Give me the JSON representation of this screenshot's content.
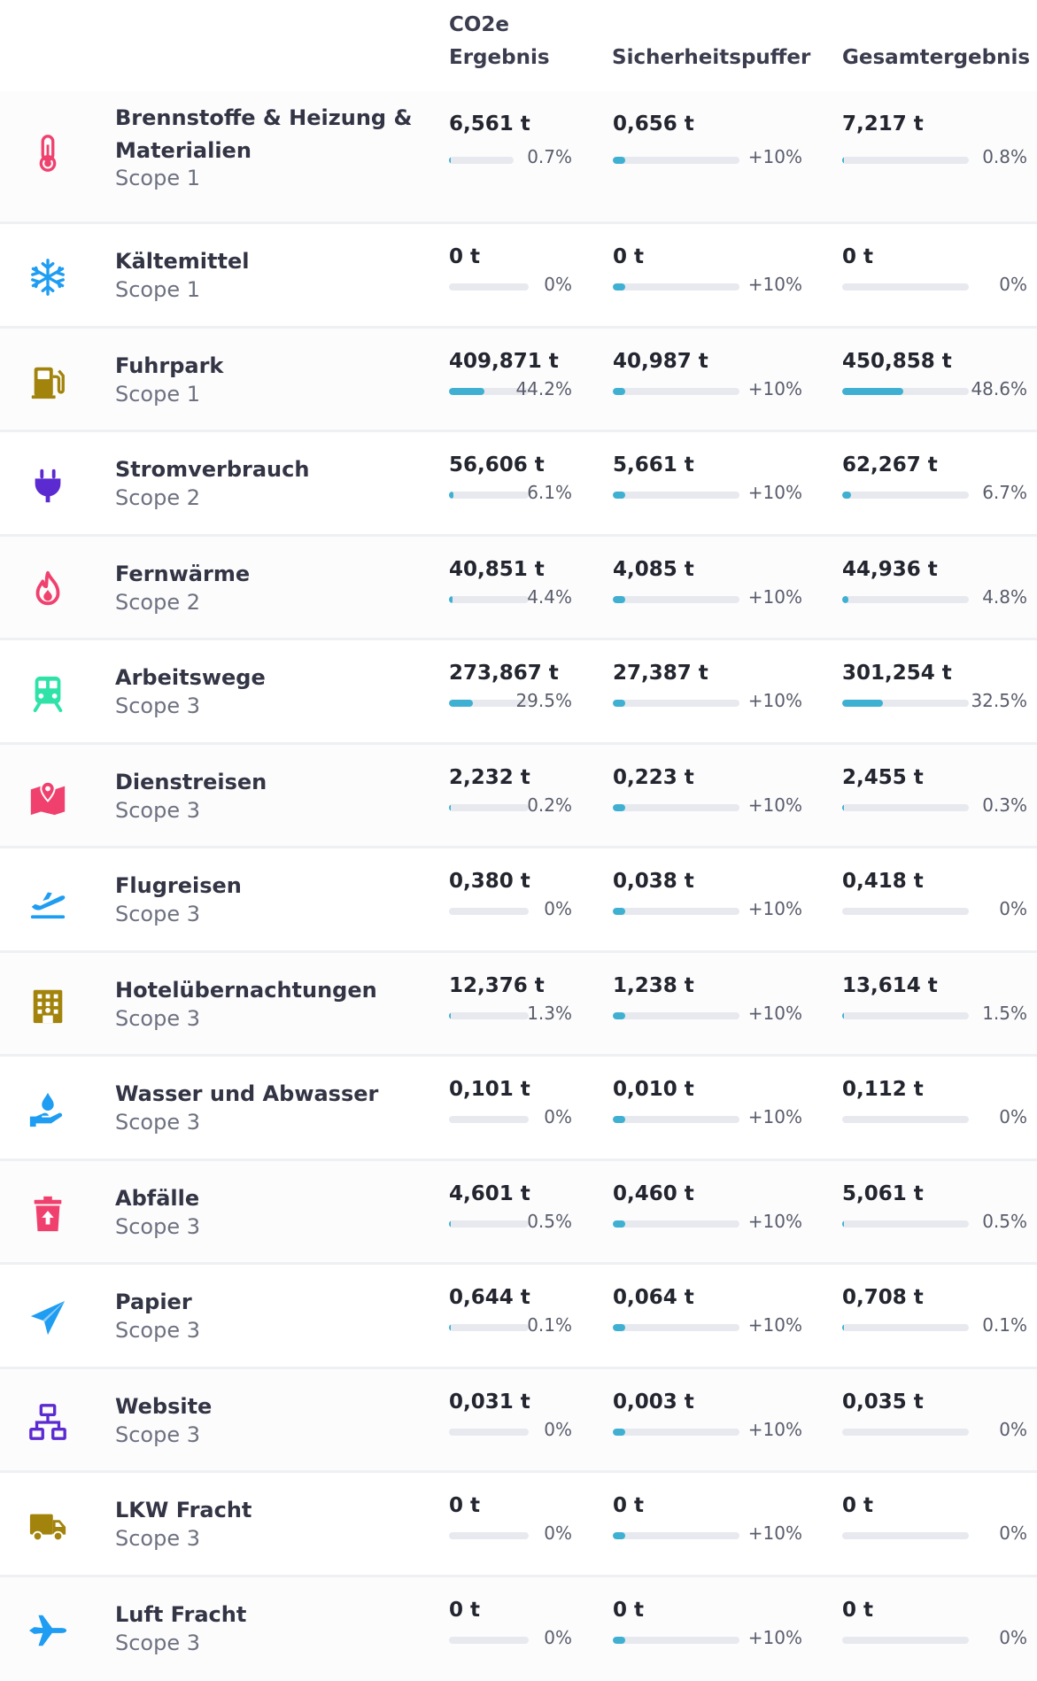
{
  "header": {
    "col1": "CO2e Ergebnis",
    "col2": "Sicherheitspuffer",
    "col3": "Gesamtergebnis"
  },
  "colors": {
    "accent": "#3fb0d2",
    "track": "#e7e9ee",
    "pink": "#f0416e",
    "blue": "#1e9df2",
    "gold": "#a2840c",
    "purple": "#5b2ad0",
    "teal": "#2ee2a8"
  },
  "rows": [
    {
      "name": "Brennstoffe & Heizung & Materialien",
      "scope": "Scope 1",
      "icon": "thermometer-icon",
      "co2": "6,561 t",
      "co2_pct": "0.7%",
      "co2_frac": 0.007,
      "buffer": "0,656 t",
      "buffer_pct": "+10%",
      "buffer_frac": 0.1,
      "total": "7,217 t",
      "total_pct": "0.8%",
      "total_frac": 0.008
    },
    {
      "name": "Kältemittel",
      "scope": "Scope 1",
      "icon": "snowflake-icon",
      "co2": "0 t",
      "co2_pct": "0%",
      "co2_frac": 0,
      "buffer": "0 t",
      "buffer_pct": "+10%",
      "buffer_frac": 0.1,
      "total": "0 t",
      "total_pct": "0%",
      "total_frac": 0
    },
    {
      "name": "Fuhrpark",
      "scope": "Scope 1",
      "icon": "fuel-pump-icon",
      "co2": "409,871 t",
      "co2_pct": "44.2%",
      "co2_frac": 0.442,
      "buffer": "40,987 t",
      "buffer_pct": "+10%",
      "buffer_frac": 0.1,
      "total": "450,858 t",
      "total_pct": "48.6%",
      "total_frac": 0.486
    },
    {
      "name": "Stromverbrauch",
      "scope": "Scope 2",
      "icon": "plug-icon",
      "co2": "56,606 t",
      "co2_pct": "6.1%",
      "co2_frac": 0.061,
      "buffer": "5,661 t",
      "buffer_pct": "+10%",
      "buffer_frac": 0.1,
      "total": "62,267 t",
      "total_pct": "6.7%",
      "total_frac": 0.067
    },
    {
      "name": "Fernwärme",
      "scope": "Scope 2",
      "icon": "flame-icon",
      "co2": "40,851 t",
      "co2_pct": "4.4%",
      "co2_frac": 0.044,
      "buffer": "4,085 t",
      "buffer_pct": "+10%",
      "buffer_frac": 0.1,
      "total": "44,936 t",
      "total_pct": "4.8%",
      "total_frac": 0.048
    },
    {
      "name": "Arbeitswege",
      "scope": "Scope 3",
      "icon": "train-icon",
      "co2": "273,867 t",
      "co2_pct": "29.5%",
      "co2_frac": 0.295,
      "buffer": "27,387 t",
      "buffer_pct": "+10%",
      "buffer_frac": 0.1,
      "total": "301,254 t",
      "total_pct": "32.5%",
      "total_frac": 0.325
    },
    {
      "name": "Dienstreisen",
      "scope": "Scope 3",
      "icon": "map-pin-icon",
      "co2": "2,232 t",
      "co2_pct": "0.2%",
      "co2_frac": 0.002,
      "buffer": "0,223 t",
      "buffer_pct": "+10%",
      "buffer_frac": 0.1,
      "total": "2,455 t",
      "total_pct": "0.3%",
      "total_frac": 0.003
    },
    {
      "name": "Flugreisen",
      "scope": "Scope 3",
      "icon": "airplane-takeoff-icon",
      "co2": "0,380 t",
      "co2_pct": "0%",
      "co2_frac": 0,
      "buffer": "0,038 t",
      "buffer_pct": "+10%",
      "buffer_frac": 0.1,
      "total": "0,418 t",
      "total_pct": "0%",
      "total_frac": 0
    },
    {
      "name": "Hotelübernachtungen",
      "scope": "Scope 3",
      "icon": "hotel-icon",
      "co2": "12,376 t",
      "co2_pct": "1.3%",
      "co2_frac": 0.013,
      "buffer": "1,238 t",
      "buffer_pct": "+10%",
      "buffer_frac": 0.1,
      "total": "13,614 t",
      "total_pct": "1.5%",
      "total_frac": 0.015
    },
    {
      "name": "Wasser und Abwasser",
      "scope": "Scope 3",
      "icon": "water-hand-icon",
      "co2": "0,101 t",
      "co2_pct": "0%",
      "co2_frac": 0,
      "buffer": "0,010 t",
      "buffer_pct": "+10%",
      "buffer_frac": 0.1,
      "total": "0,112 t",
      "total_pct": "0%",
      "total_frac": 0
    },
    {
      "name": "Abfälle",
      "scope": "Scope 3",
      "icon": "trash-icon",
      "co2": "4,601 t",
      "co2_pct": "0.5%",
      "co2_frac": 0.005,
      "buffer": "0,460 t",
      "buffer_pct": "+10%",
      "buffer_frac": 0.1,
      "total": "5,061 t",
      "total_pct": "0.5%",
      "total_frac": 0.005
    },
    {
      "name": "Papier",
      "scope": "Scope 3",
      "icon": "paper-plane-icon",
      "co2": "0,644 t",
      "co2_pct": "0.1%",
      "co2_frac": 0.001,
      "buffer": "0,064 t",
      "buffer_pct": "+10%",
      "buffer_frac": 0.1,
      "total": "0,708 t",
      "total_pct": "0.1%",
      "total_frac": 0.001
    },
    {
      "name": "Website",
      "scope": "Scope 3",
      "icon": "network-icon",
      "co2": "0,031 t",
      "co2_pct": "0%",
      "co2_frac": 0,
      "buffer": "0,003 t",
      "buffer_pct": "+10%",
      "buffer_frac": 0.1,
      "total": "0,035 t",
      "total_pct": "0%",
      "total_frac": 0
    },
    {
      "name": "LKW Fracht",
      "scope": "Scope 3",
      "icon": "truck-icon",
      "co2": "0 t",
      "co2_pct": "0%",
      "co2_frac": 0,
      "buffer": "0 t",
      "buffer_pct": "+10%",
      "buffer_frac": 0.1,
      "total": "0 t",
      "total_pct": "0%",
      "total_frac": 0
    },
    {
      "name": "Luft Fracht",
      "scope": "Scope 3",
      "icon": "airplane-icon",
      "co2": "0 t",
      "co2_pct": "0%",
      "co2_frac": 0,
      "buffer": "0 t",
      "buffer_pct": "+10%",
      "buffer_frac": 0.1,
      "total": "0 t",
      "total_pct": "0%",
      "total_frac": 0
    }
  ]
}
